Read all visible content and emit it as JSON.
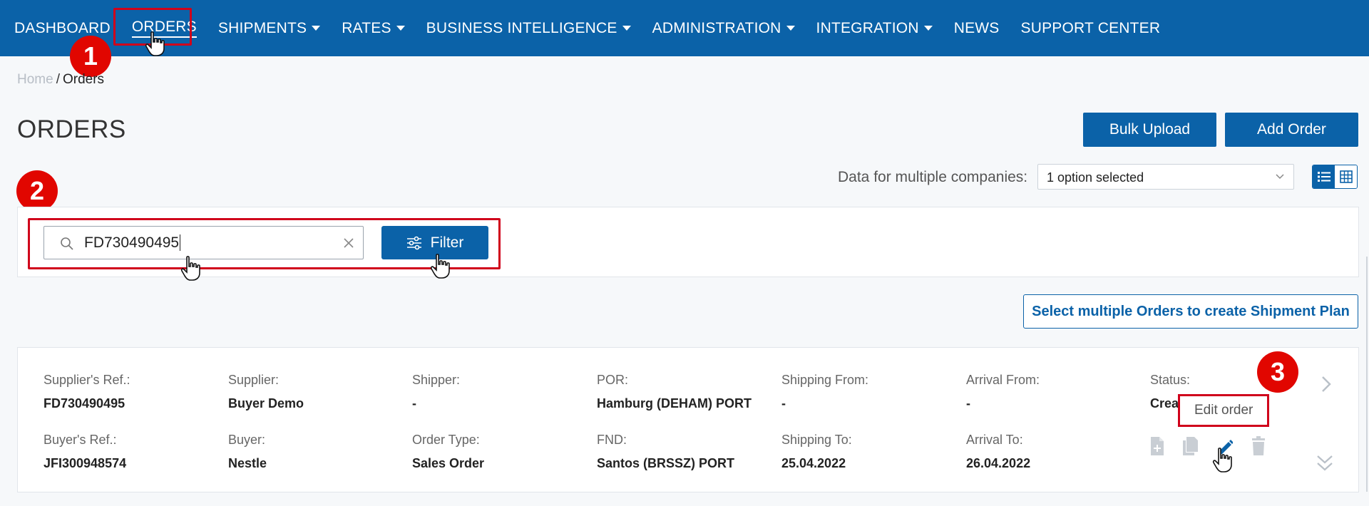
{
  "nav": {
    "items": [
      {
        "label": "DASHBOARD",
        "caret": false
      },
      {
        "label": "ORDERS",
        "caret": false,
        "active": true
      },
      {
        "label": "SHIPMENTS",
        "caret": true
      },
      {
        "label": "RATES",
        "caret": true
      },
      {
        "label": "BUSINESS INTELLIGENCE",
        "caret": true
      },
      {
        "label": "ADMINISTRATION",
        "caret": true
      },
      {
        "label": "INTEGRATION",
        "caret": true
      },
      {
        "label": "NEWS",
        "caret": false
      },
      {
        "label": "SUPPORT CENTER",
        "caret": false
      }
    ]
  },
  "steps": {
    "one": "1",
    "two": "2",
    "three": "3"
  },
  "breadcrumb": {
    "home": "Home",
    "separator": "/",
    "current": "Orders"
  },
  "page": {
    "title": "ORDERS"
  },
  "actions": {
    "bulk_upload": "Bulk Upload",
    "add_order": "Add Order"
  },
  "companies": {
    "label": "Data for multiple companies:",
    "selected": "1 option selected"
  },
  "search": {
    "value": "FD730490495",
    "filter_label": "Filter"
  },
  "shipment_plan_label": "Select multiple Orders to create Shipment Plan",
  "order": {
    "row1": [
      {
        "label": "Supplier's Ref.:",
        "value": "FD730490495"
      },
      {
        "label": "Supplier:",
        "value": "Buyer Demo"
      },
      {
        "label": "Shipper:",
        "value": "-"
      },
      {
        "label": "POR:",
        "value": "Hamburg (DEHAM) PORT"
      },
      {
        "label": "Shipping From:",
        "value": "-"
      },
      {
        "label": "Arrival From:",
        "value": "-"
      },
      {
        "label": "Status:",
        "value": "Crea"
      }
    ],
    "row2": [
      {
        "label": "Buyer's Ref.:",
        "value": "JFI300948574"
      },
      {
        "label": "Buyer:",
        "value": "Nestle"
      },
      {
        "label": "Order Type:",
        "value": "Sales Order"
      },
      {
        "label": "FND:",
        "value": "Santos (BRSSZ) PORT"
      },
      {
        "label": "Shipping To:",
        "value": "25.04.2022"
      },
      {
        "label": "Arrival To:",
        "value": "26.04.2022"
      }
    ],
    "tooltip": "Edit order"
  },
  "colors": {
    "brand": "#0b62a8",
    "highlight": "#d0021b",
    "badge": "#e10600"
  }
}
